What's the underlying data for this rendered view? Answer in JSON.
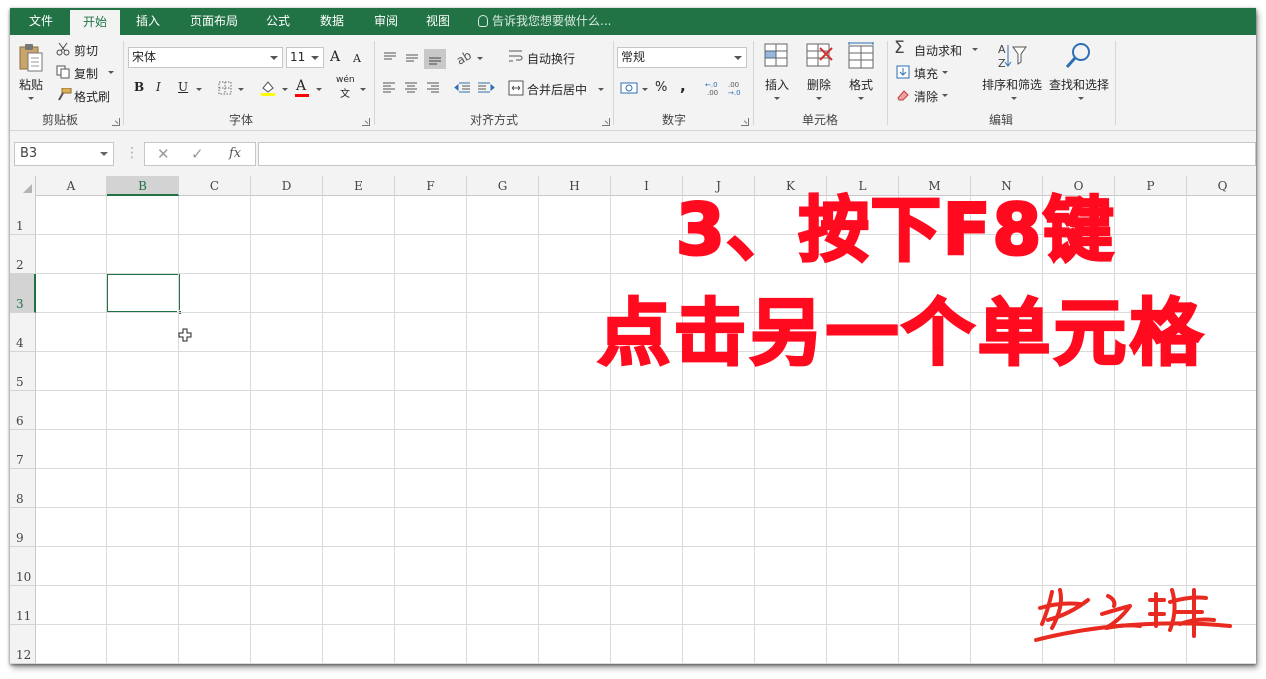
{
  "tabs": [
    {
      "label": "文件"
    },
    {
      "label": "开始"
    },
    {
      "label": "插入"
    },
    {
      "label": "页面布局"
    },
    {
      "label": "公式"
    },
    {
      "label": "数据"
    },
    {
      "label": "审阅"
    },
    {
      "label": "视图"
    }
  ],
  "active_tab": "开始",
  "tell_me": "告诉我您想要做什么...",
  "clipboard": {
    "paste": "粘贴",
    "cut": "剪切",
    "copy": "复制",
    "format_painter": "格式刷",
    "label": "剪贴板"
  },
  "font": {
    "name": "宋体",
    "size": "11",
    "bold": "B",
    "italic": "I",
    "underline": "U",
    "label": "字体",
    "grow": "A",
    "shrink": "A",
    "font_color": "A",
    "phonetic_top": "wén",
    "phonetic_bottom": "文"
  },
  "alignment": {
    "wrap": "自动换行",
    "merge": "合并后居中",
    "label": "对齐方式"
  },
  "number": {
    "format": "常规",
    "percent": "%",
    "comma": ",",
    "label": "数字"
  },
  "cells_group": {
    "insert": "插入",
    "delete": "删除",
    "format": "格式",
    "label": "单元格"
  },
  "editing": {
    "autosum": "自动求和",
    "fill": "填充",
    "clear": "清除",
    "sort_filter": "排序和筛选",
    "find_select": "查找和选择",
    "label": "编辑"
  },
  "formula_bar": {
    "name_box": "B3",
    "cancel": "✕",
    "enter": "✓",
    "fx": "fx",
    "formula": ""
  },
  "columns": [
    "A",
    "B",
    "C",
    "D",
    "E",
    "F",
    "G",
    "H",
    "I",
    "J",
    "K",
    "L",
    "M",
    "N",
    "O",
    "P",
    "Q"
  ],
  "rows": [
    "1",
    "2",
    "3",
    "4",
    "5",
    "6",
    "7",
    "8",
    "9",
    "10",
    "11",
    "12"
  ],
  "selected_column": "B",
  "selected_row": "3",
  "captions": {
    "line1": "3、按下F8键",
    "line2": "点击另一个单元格"
  },
  "signature_text": "张之峰",
  "colors": {
    "accent": "#217346",
    "caption": "#ff0a1e"
  }
}
